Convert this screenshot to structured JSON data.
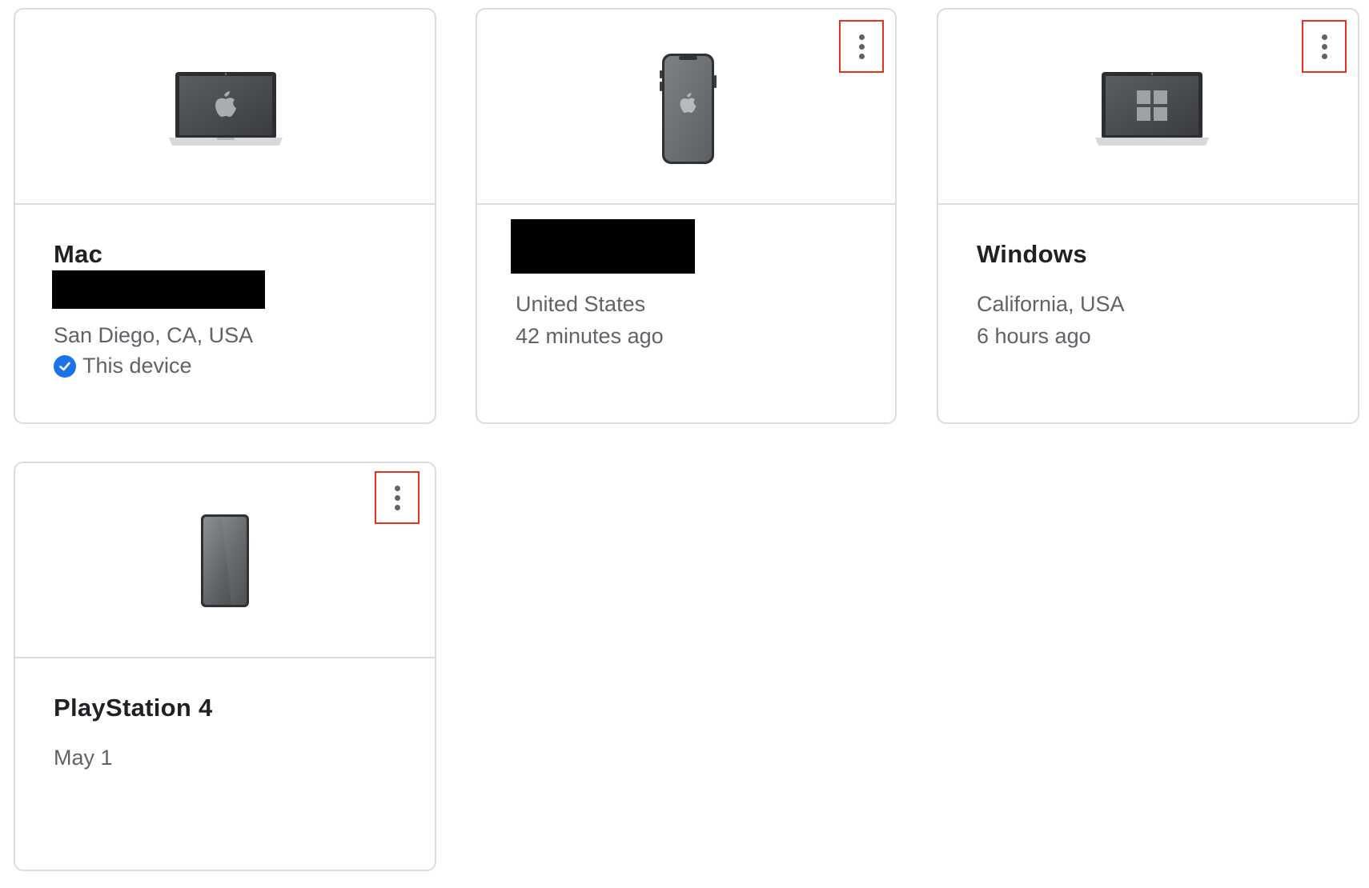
{
  "devices": [
    {
      "name": "Mac",
      "location": "San Diego, CA, USA",
      "status": "This device",
      "icon": "macbook-icon"
    },
    {
      "location": "United States",
      "last_seen": "42 minutes ago",
      "icon": "iphone-icon"
    },
    {
      "name": "Windows",
      "location": "California, USA",
      "last_seen": "6 hours ago",
      "icon": "windows-laptop-icon"
    },
    {
      "name": "PlayStation 4",
      "last_seen": "May 1",
      "icon": "generic-phone-icon"
    }
  ],
  "colors": {
    "border": "#dadce0",
    "highlight": "#e0341e",
    "check": "#1a73e8",
    "text_primary": "#202124",
    "text_secondary": "#5f6368"
  }
}
